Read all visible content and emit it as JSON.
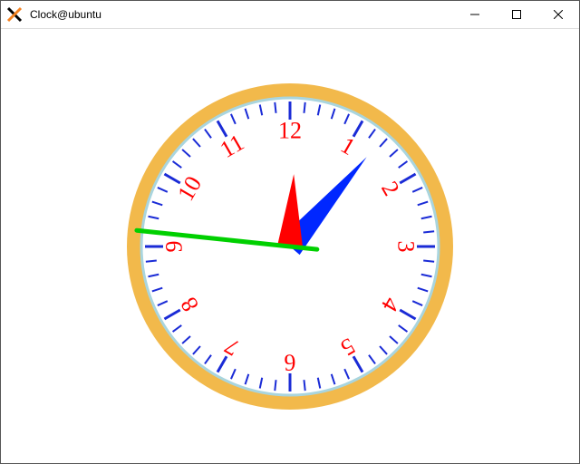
{
  "window": {
    "title": "Clock@ubuntu",
    "buttons": {
      "minimize": "–",
      "maximize": "□",
      "close": "×"
    }
  },
  "clock": {
    "numerals": [
      "12",
      "1",
      "2",
      "3",
      "4",
      "5",
      "6",
      "7",
      "8",
      "9",
      "10",
      "11"
    ],
    "time": {
      "hours": 12,
      "minutes": 6,
      "seconds": 46
    },
    "colors": {
      "bezel": "#f2b94b",
      "bezel_inner": "#a9d5de",
      "face": "#ffffff",
      "ticks": "#1a2bd6",
      "numerals": "#ff0000",
      "hour_hand": "#ff0000",
      "minute_hand": "#0027ff",
      "second_hand": "#00d000"
    },
    "geometry": {
      "radius": 180,
      "tick_outer": 160,
      "tick_minor_inner": 148,
      "tick_major_inner": 140,
      "numeral_radius": 128,
      "hour_hand_len": 80,
      "minute_hand_len": 130,
      "second_hand_len": 170,
      "second_hand_back": 30
    }
  }
}
